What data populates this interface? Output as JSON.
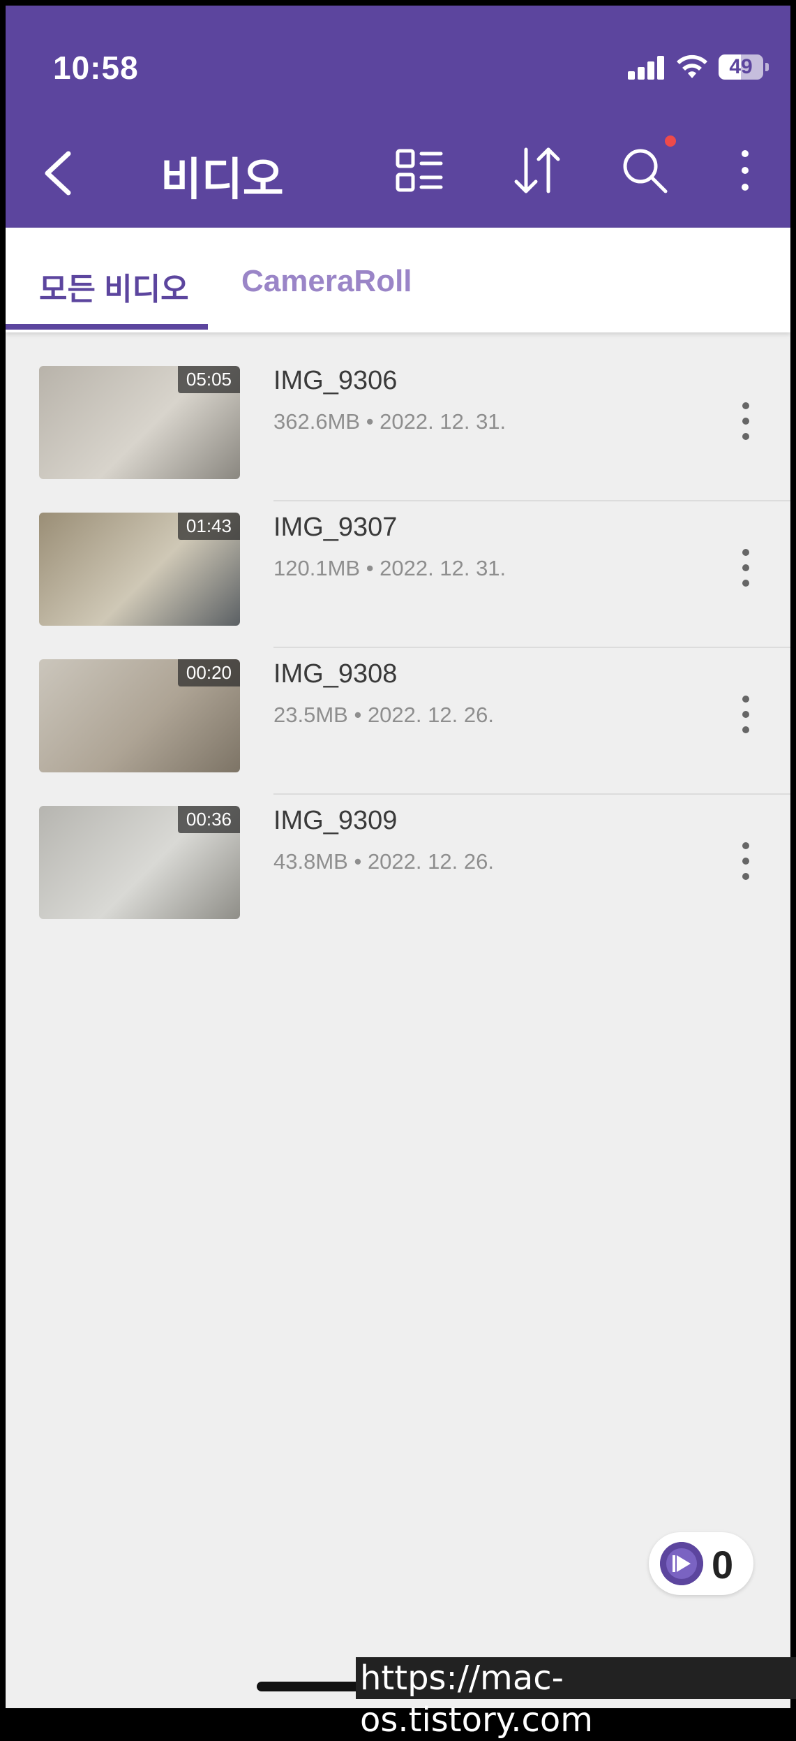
{
  "status_bar": {
    "time": "10:58",
    "battery": "49"
  },
  "app_bar": {
    "title": "비디오"
  },
  "tabs": [
    {
      "label": "모든 비디오"
    },
    {
      "label": "CameraRoll"
    }
  ],
  "videos": [
    {
      "name": "IMG_9306",
      "size": "362.6MB",
      "date": "2022. 12. 31.",
      "duration": "05:05",
      "thumb_colors": [
        "#b8b3aa",
        "#d8d4cc",
        "#8a8780"
      ]
    },
    {
      "name": "IMG_9307",
      "size": "120.1MB",
      "date": "2022. 12. 31.",
      "duration": "01:43",
      "thumb_colors": [
        "#9a8e76",
        "#cfc8b6",
        "#5b6064"
      ]
    },
    {
      "name": "IMG_9308",
      "size": "23.5MB",
      "date": "2022. 12. 26.",
      "duration": "00:20",
      "thumb_colors": [
        "#cbc6bc",
        "#aea495",
        "#7d7466"
      ]
    },
    {
      "name": "IMG_9309",
      "size": "43.8MB",
      "date": "2022. 12. 26.",
      "duration": "00:36",
      "thumb_colors": [
        "#b6b5b0",
        "#d9d9d5",
        "#8f8e88"
      ]
    }
  ],
  "queue_badge": {
    "count": "0"
  },
  "watermark": "https://mac-os.tistory.com",
  "colors": {
    "accent": "#5c459e",
    "tab_inactive": "#9a85c7",
    "notification_dot": "#ef4a4a"
  }
}
